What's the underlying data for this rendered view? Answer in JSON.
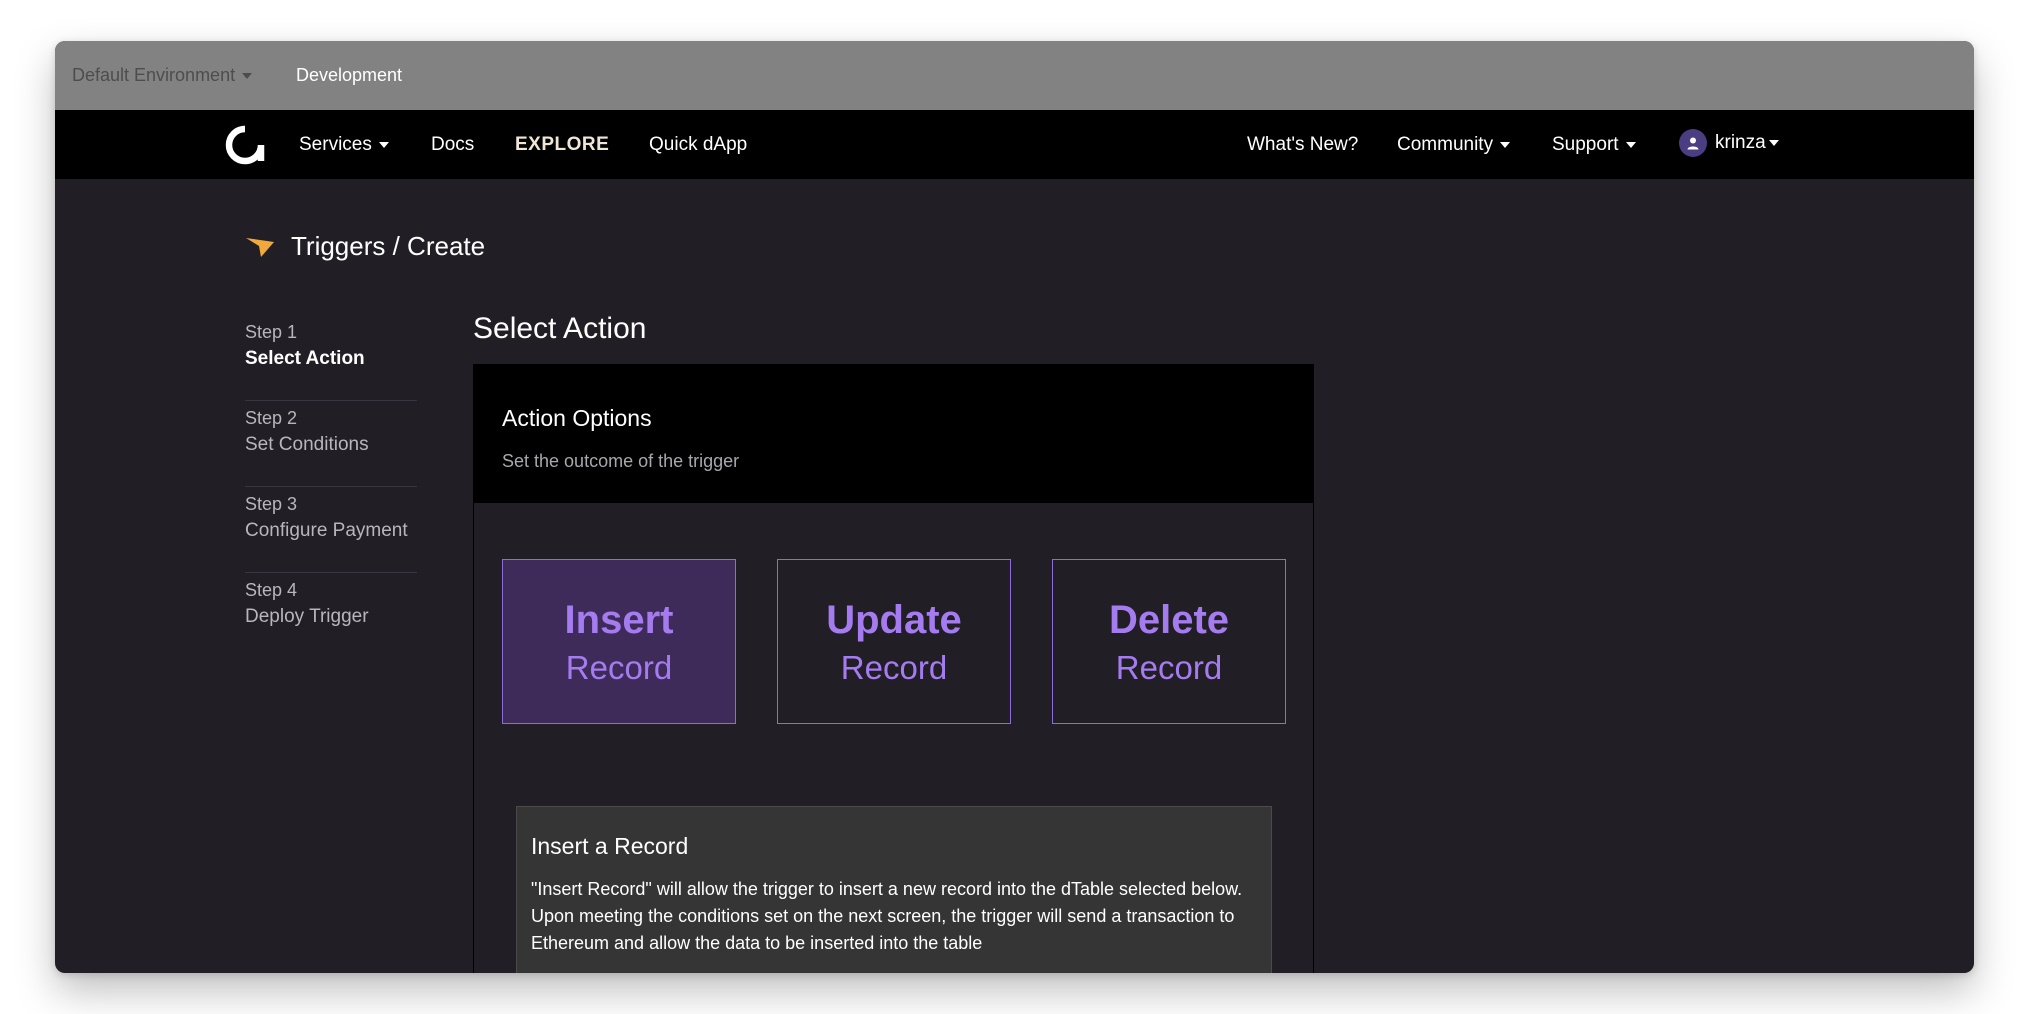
{
  "env": {
    "environment": "Default Environment",
    "tab": "Development"
  },
  "nav": {
    "services": "Services",
    "docs": "Docs",
    "explore": "EXPLORE",
    "quick_dapp": "Quick dApp",
    "whats_new": "What's New?",
    "community": "Community",
    "support": "Support",
    "user": "krinza"
  },
  "page": {
    "title": "Triggers / Create",
    "section_title": "Select Action"
  },
  "steps": [
    {
      "num": "Step 1",
      "name": "Select Action",
      "active": true
    },
    {
      "num": "Step 2",
      "name": "Set Conditions",
      "active": false
    },
    {
      "num": "Step 3",
      "name": "Configure Payment",
      "active": false
    },
    {
      "num": "Step 4",
      "name": "Deploy Trigger",
      "active": false
    }
  ],
  "panel": {
    "title": "Action Options",
    "subtitle": "Set the outcome of the trigger",
    "options": [
      {
        "top": "Insert",
        "bottom": "Record",
        "selected": true
      },
      {
        "top": "Update",
        "bottom": "Record",
        "selected": false
      },
      {
        "top": "Delete",
        "bottom": "Record",
        "selected": false
      }
    ],
    "info_title": "Insert a Record",
    "info_body": "\"Insert Record\" will allow the trigger to insert a new record into the dTable selected below. Upon meeting the conditions set on the next screen, the trigger will send a transaction to Ethereum and allow the data to be inserted into the table"
  },
  "colors": {
    "accent": "#a57cf0",
    "trigger_icon": "#f2a93b",
    "avatar": "#4a3d82"
  }
}
